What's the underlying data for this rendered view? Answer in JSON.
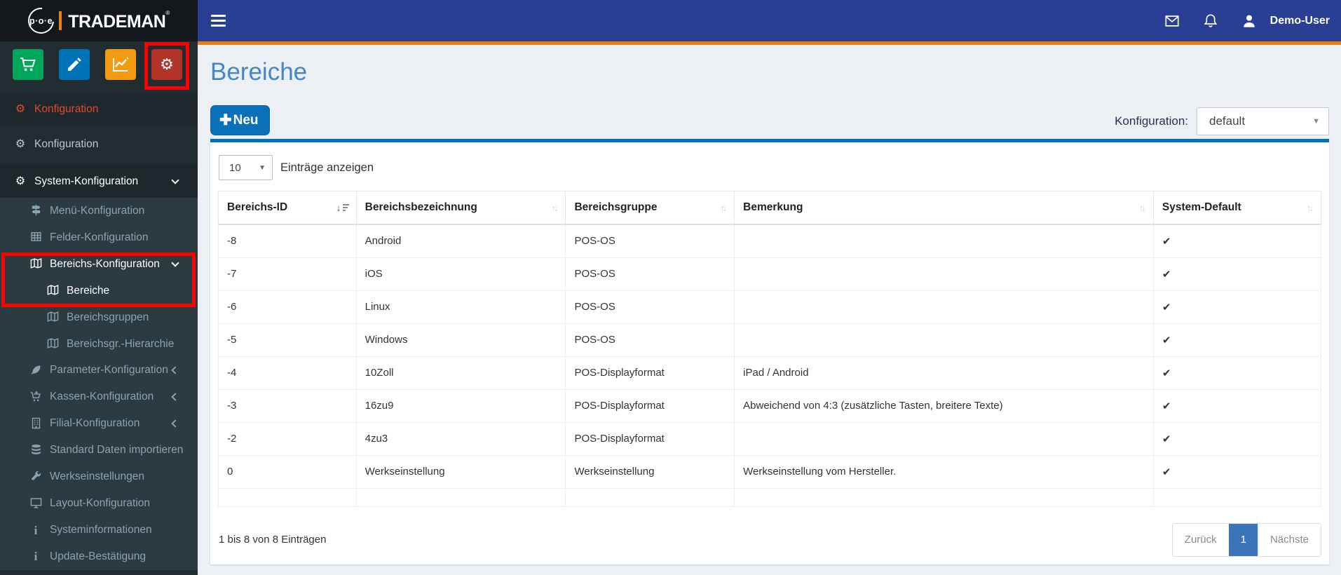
{
  "logo": {
    "poe": "p·o·e",
    "brand": "TRADEMAN",
    "reg": "®"
  },
  "topbar": {
    "username": "Demo-User"
  },
  "shortcuts": {
    "cart_color": "#00a65a",
    "pencil_color": "#0073b7",
    "chart_color": "#f39c12",
    "gears_color": "#b13426"
  },
  "sidebar": {
    "items": {
      "konfig_active": "Konfiguration",
      "konfig": "Konfiguration",
      "system_konfig": "System-Konfiguration",
      "menu_konfig": "Menü-Konfiguration",
      "felder_konfig": "Felder-Konfiguration",
      "bereichs_konfig": "Bereichs-Konfiguration",
      "bereiche": "Bereiche",
      "bereichsgruppen": "Bereichsgruppen",
      "bereichsgr_hierarchie": "Bereichsgr.-Hierarchie",
      "parameter_konfig": "Parameter-Konfiguration",
      "kassen_konfig": "Kassen-Konfiguration",
      "filial_konfig": "Filial-Konfiguration",
      "standard_daten": "Standard Daten importieren",
      "werkseinstellungen": "Werkseinstellungen",
      "layout_konfig": "Layout-Konfiguration",
      "systeminformationen": "Systeminformationen",
      "update_bestaetigung": "Update-Bestätigung"
    }
  },
  "page": {
    "title": "Bereiche",
    "new_button": "Neu",
    "config_label": "Konfiguration:",
    "config_value": "default"
  },
  "table": {
    "length_value": "10",
    "length_label": "Einträge anzeigen",
    "columns": {
      "c1": "Bereichs-ID",
      "c2": "Bereichsbezeichnung",
      "c3": "Bereichsgruppe",
      "c4": "Bemerkung",
      "c5": "System-Default"
    },
    "rows": [
      {
        "id": "-8",
        "name": "Android",
        "group": "POS-OS",
        "note": "",
        "default": "✔"
      },
      {
        "id": "-7",
        "name": "iOS",
        "group": "POS-OS",
        "note": "",
        "default": "✔"
      },
      {
        "id": "-6",
        "name": "Linux",
        "group": "POS-OS",
        "note": "",
        "default": "✔"
      },
      {
        "id": "-5",
        "name": "Windows",
        "group": "POS-OS",
        "note": "",
        "default": "✔"
      },
      {
        "id": "-4",
        "name": "10Zoll",
        "group": "POS-Displayformat",
        "note": "iPad / Android",
        "default": "✔"
      },
      {
        "id": "-3",
        "name": "16zu9",
        "group": "POS-Displayformat",
        "note": "Abweichend von 4:3 (zusätzliche Tasten, breitere Texte)",
        "default": "✔"
      },
      {
        "id": "-2",
        "name": "4zu3",
        "group": "POS-Displayformat",
        "note": "",
        "default": "✔"
      },
      {
        "id": "0",
        "name": "Werkseinstellung",
        "group": "Werkseinstellung",
        "note": "Werkseinstellung vom Hersteller.",
        "default": "✔"
      }
    ],
    "info": "1 bis 8 von 8 Einträgen",
    "pagination": {
      "prev": "Zurück",
      "page": "1",
      "next": "Nächste"
    }
  }
}
